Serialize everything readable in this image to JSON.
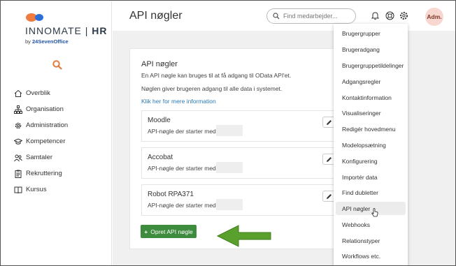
{
  "logo": {
    "brand_left": "INNOMATE",
    "brand_sep": "|",
    "brand_right": "HR",
    "by": "by",
    "company": "24SevenOffice"
  },
  "sidebar": {
    "items": [
      {
        "label": "Overblik",
        "icon": "home-icon"
      },
      {
        "label": "Organisation",
        "icon": "org-chart-icon"
      },
      {
        "label": "Administration",
        "icon": "gear-icon"
      },
      {
        "label": "Kompetencer",
        "icon": "graduation-cap-icon"
      },
      {
        "label": "Samtaler",
        "icon": "people-icon"
      },
      {
        "label": "Rekruttering",
        "icon": "clipboard-icon"
      },
      {
        "label": "Kursus",
        "icon": "book-icon"
      }
    ]
  },
  "header": {
    "title": "API nøgler",
    "search_placeholder": "Find medarbejder...",
    "avatar": "Adm."
  },
  "card": {
    "title": "API nøgler",
    "desc1": "En API nøgle kan bruges til at få adgang til OData API'et.",
    "desc2": "Nøglen giver brugeren adgang til alle data i systemet.",
    "link": "Klik her for mere information",
    "keys": [
      {
        "name": "Moodle",
        "prefix": "API-nøgle der starter med:"
      },
      {
        "name": "Accobat",
        "prefix": "API-nøgle der starter med:"
      },
      {
        "name": "Robot RPA371",
        "prefix": "API-nøgle der starter med:"
      }
    ],
    "create_label": "Opret API nøgle"
  },
  "menu": {
    "items": [
      "Brugergrupper",
      "Brugeradgang",
      "Brugergruppetildelinger",
      "Adgangsregler",
      "Kontaktinformation",
      "Visualiseringer",
      "Redigér hovedmenu",
      "Modelopsætning",
      "Konfigurering",
      "Importér data",
      "Find dubletter",
      "API nøgler",
      "Webhooks",
      "Relationstyper",
      "Workflows etc."
    ],
    "active": "API nøgler"
  },
  "colors": {
    "accent_green": "#3d8b3d",
    "arrow_green": "#5aa02c",
    "link_blue": "#2a7ab8",
    "logo_orange": "#f07b3f",
    "logo_blue": "#2b6fd6"
  }
}
